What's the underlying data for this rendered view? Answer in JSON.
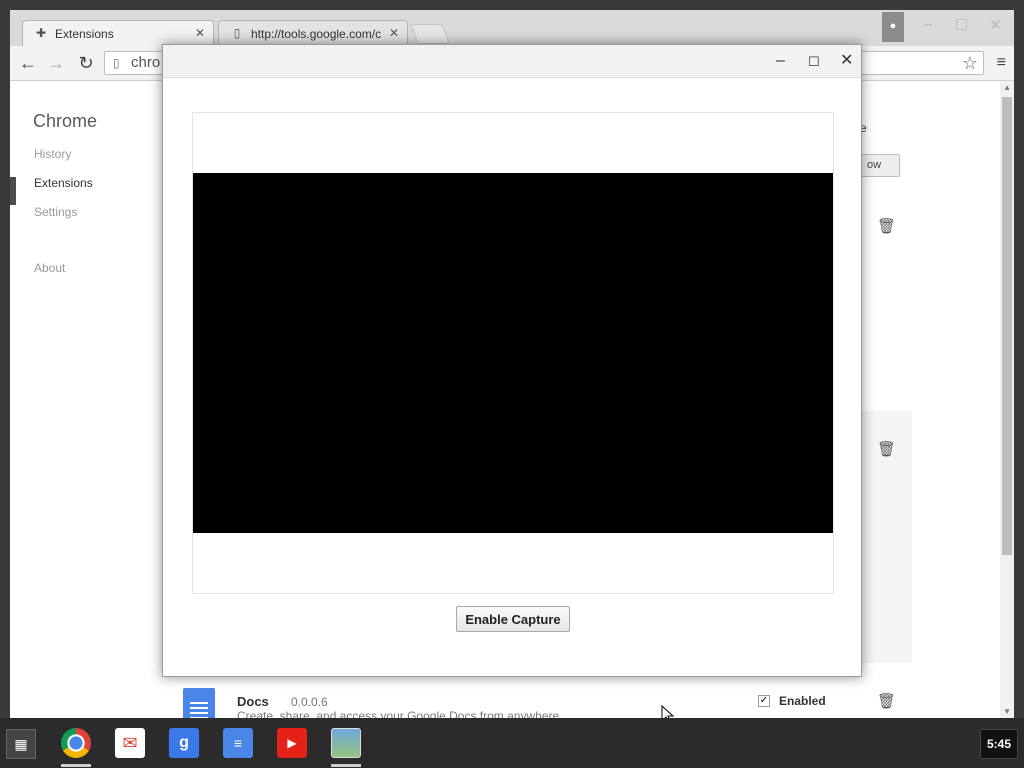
{
  "tabs": [
    {
      "title": "Extensions",
      "icon": "puzzle-icon",
      "active": true
    },
    {
      "title": "http://tools.google.com/c",
      "icon": "page-icon",
      "active": false
    }
  ],
  "omnibox": {
    "value": "chro"
  },
  "sidebar": {
    "title": "Chrome",
    "items": [
      "History",
      "Extensions",
      "Settings",
      "About"
    ],
    "selected": "Extensions"
  },
  "background_page": {
    "title_fragment": "e",
    "button_fragment": "ow",
    "extension": {
      "name": "Docs",
      "version": "0.0.0.6",
      "description": "Create, share, and access your Google Docs from anywhere",
      "enabled_label": "Enabled",
      "enabled": true
    }
  },
  "dialog": {
    "button_label": "Enable Capture"
  },
  "shelf": {
    "apps": [
      "chrome-icon",
      "gmail-icon",
      "google-search-icon",
      "docs-icon",
      "youtube-icon",
      "photos-icon"
    ],
    "clock": "5:45"
  },
  "colors": {
    "selected_nav_marker": "#4d4d4d",
    "docs_blue": "#4a86e8",
    "youtube_red": "#e62117",
    "google_blue": "#3b78e7"
  }
}
